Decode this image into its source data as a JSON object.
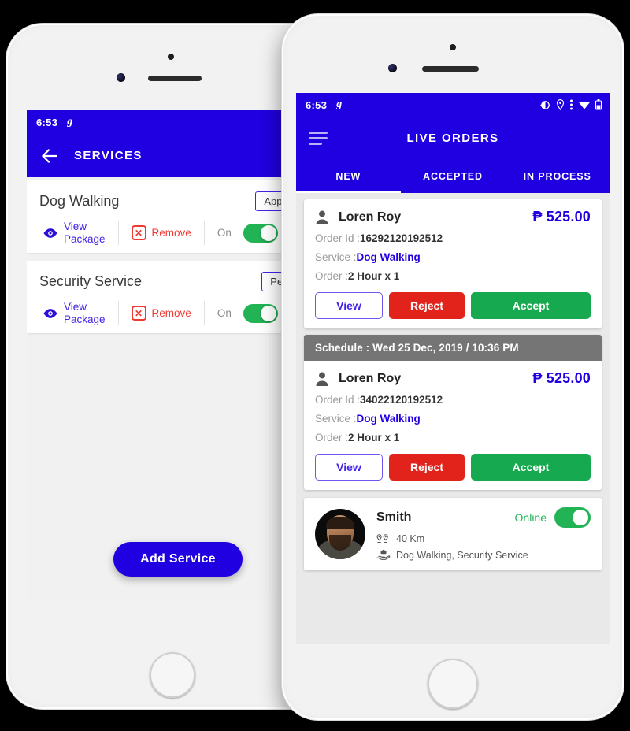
{
  "left_phone": {
    "status_bar": {
      "time": "6:53",
      "app_glyph": "g"
    },
    "app_bar": {
      "title": "SERVICES",
      "back_icon": "arrow-left-icon"
    },
    "services": [
      {
        "title": "Dog Walking",
        "status": "Approved",
        "view_label": "View\nPackage",
        "view_label_line1": "View",
        "view_label_line2": "Package",
        "remove_label": "Remove",
        "toggle_label": "On",
        "toggle_on": true
      },
      {
        "title": "Security Service",
        "status": "Pending",
        "view_label_line1": "View",
        "view_label_line2": "Package",
        "remove_label": "Remove",
        "toggle_label": "On",
        "toggle_on": true
      }
    ],
    "add_service_label": "Add Service"
  },
  "right_phone": {
    "status_bar": {
      "time": "6:53",
      "app_glyph": "g"
    },
    "app_bar": {
      "title": "LIVE ORDERS",
      "menu_icon": "hamburger-icon"
    },
    "tabs": [
      {
        "label": "NEW",
        "active": true
      },
      {
        "label": "ACCEPTED",
        "active": false
      },
      {
        "label": "IN PROCESS",
        "active": false
      }
    ],
    "orders": [
      {
        "schedule": null,
        "customer": "Loren Roy",
        "price": "₱ 525.00",
        "order_id_label": "Order Id :",
        "order_id": "16292120192512",
        "service_label": "Service :",
        "service": "Dog Walking",
        "order_label": "Order :",
        "order_detail": "2 Hour x 1",
        "buttons": {
          "view": "View",
          "reject": "Reject",
          "accept": "Accept"
        }
      },
      {
        "schedule": "Schedule : Wed 25 Dec, 2019 / 10:36 PM",
        "customer": "Loren Roy",
        "price": "₱ 525.00",
        "order_id_label": "Order Id :",
        "order_id": "34022120192512",
        "service_label": "Service :",
        "service": "Dog Walking",
        "order_label": "Order :",
        "order_detail": "2 Hour x 1",
        "buttons": {
          "view": "View",
          "reject": "Reject",
          "accept": "Accept"
        }
      }
    ],
    "profile": {
      "name": "Smith",
      "online_label": "Online",
      "online": true,
      "distance": "40 Km",
      "services": "Dog Walking, Security Service"
    }
  },
  "colors": {
    "primary_blue": "#2000e0",
    "accent_green": "#22b355",
    "accept_green": "#17a94f",
    "reject_red": "#e2231b",
    "remove_red": "#ef3a32",
    "schedule_gray": "#757575",
    "link_violet": "#4422e8"
  }
}
